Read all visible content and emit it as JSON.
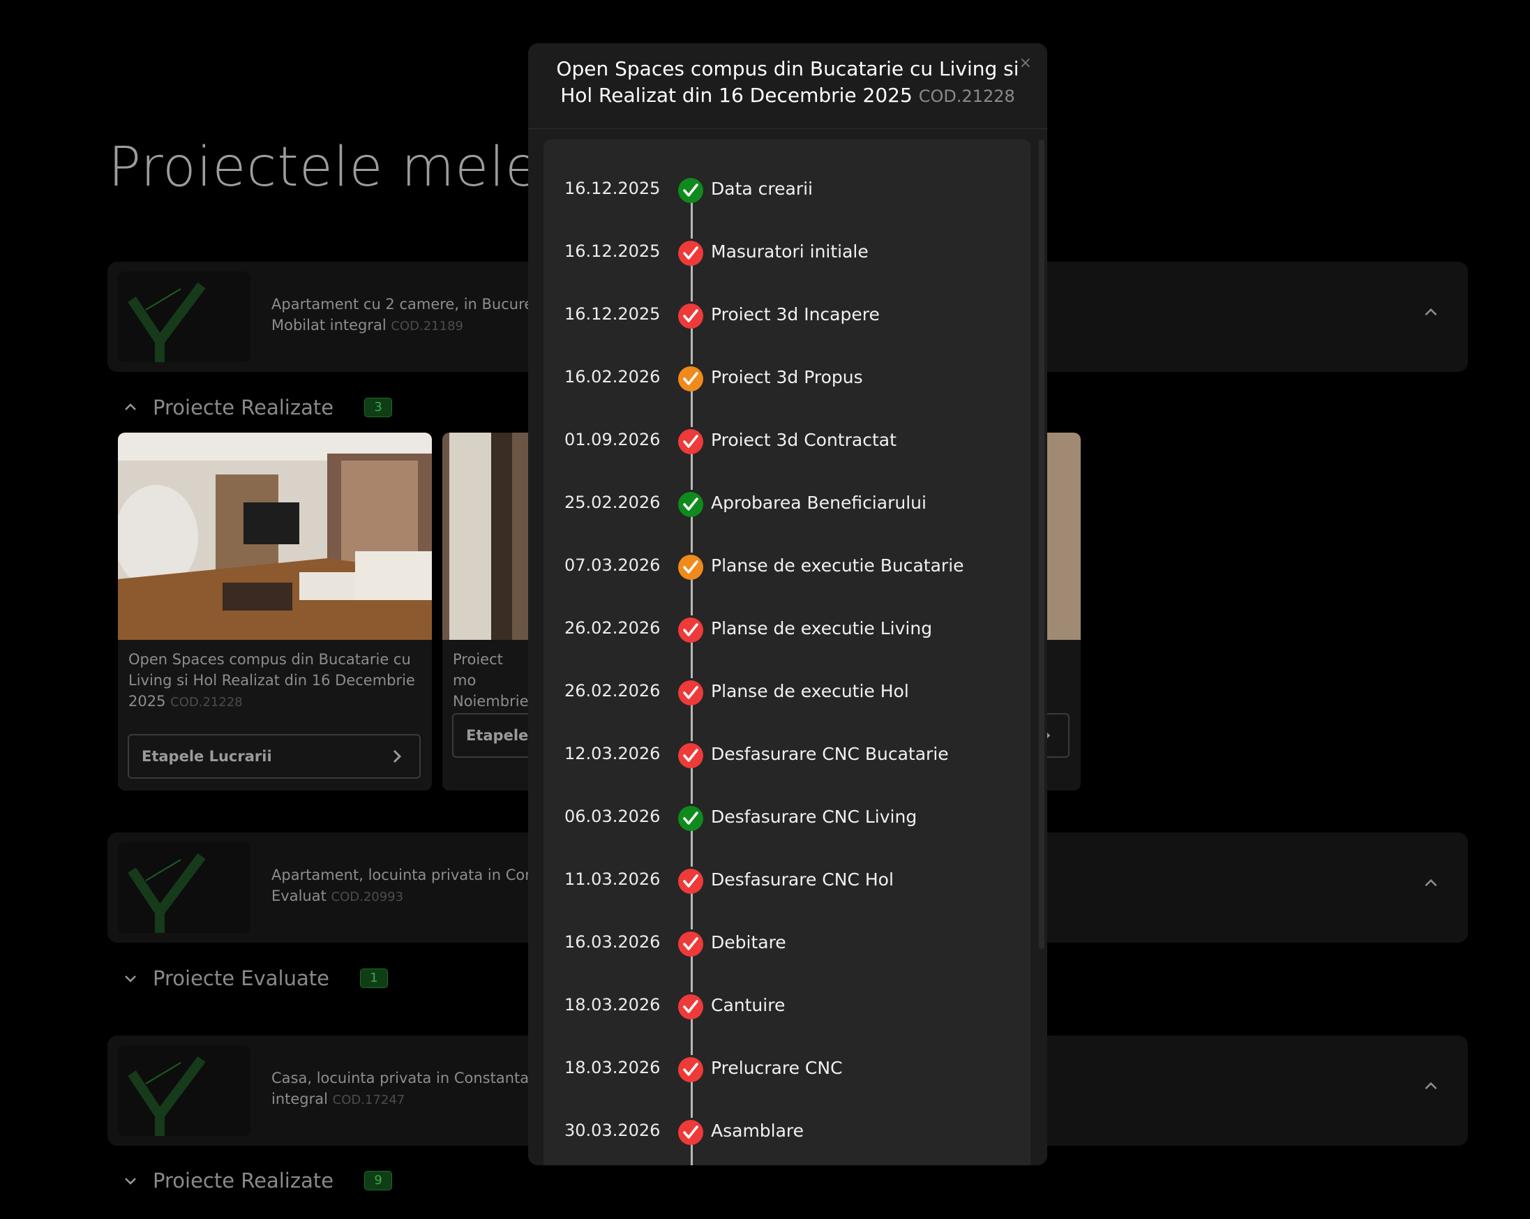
{
  "page": {
    "title": "Proiectele mele"
  },
  "projects": [
    {
      "title": "Apartament cu 2 camere, in Bucure",
      "status": "Mobilat integral",
      "code": "COD.21189",
      "section": {
        "label": "Proiecte Realizate",
        "count": "3",
        "cards": [
          {
            "title": "Open Spaces compus din Bucatarie cu Living si Hol Realizat din 16 Decembrie 2025",
            "code": "COD.21228",
            "button": "Etapele Lucrarii"
          },
          {
            "title": "Proiect mo Noiembrie",
            "code": "",
            "button": "Etapele"
          }
        ]
      }
    },
    {
      "title": "Apartament, locuinta privata in Cor",
      "status": "Evaluat",
      "code": "COD.20993",
      "section": {
        "label": "Proiecte Evaluate",
        "count": "1"
      }
    },
    {
      "title": "Casa, locuinta privata in Constanta,",
      "status": "integral",
      "code": "COD.17247",
      "section": {
        "label": "Proiecte Realizate",
        "count": "9"
      }
    }
  ],
  "modal": {
    "title": "Open Spaces compus din Bucatarie cu Living si Hol Realizat din 16 Decembrie 2025",
    "code": "COD.21228",
    "close": "×",
    "steps": [
      {
        "date": "16.12.2025",
        "label": "Data crearii",
        "status": "green"
      },
      {
        "date": "16.12.2025",
        "label": "Masuratori initiale",
        "status": "red"
      },
      {
        "date": "16.12.2025",
        "label": "Proiect 3d Incapere",
        "status": "red"
      },
      {
        "date": "16.02.2026",
        "label": "Proiect 3d Propus",
        "status": "orange"
      },
      {
        "date": "01.09.2026",
        "label": "Proiect 3d Contractat",
        "status": "red"
      },
      {
        "date": "25.02.2026",
        "label": "Aprobarea Beneficiarului",
        "status": "green"
      },
      {
        "date": "07.03.2026",
        "label": "Planse de executie Bucatarie",
        "status": "orange"
      },
      {
        "date": "26.02.2026",
        "label": "Planse de executie Living",
        "status": "red"
      },
      {
        "date": "26.02.2026",
        "label": "Planse de executie Hol",
        "status": "red"
      },
      {
        "date": "12.03.2026",
        "label": "Desfasurare CNC Bucatarie",
        "status": "red"
      },
      {
        "date": "06.03.2026",
        "label": "Desfasurare CNC Living",
        "status": "green"
      },
      {
        "date": "11.03.2026",
        "label": "Desfasurare CNC Hol",
        "status": "red"
      },
      {
        "date": "16.03.2026",
        "label": "Debitare",
        "status": "red"
      },
      {
        "date": "18.03.2026",
        "label": "Cantuire",
        "status": "red"
      },
      {
        "date": "18.03.2026",
        "label": "Prelucrare CNC",
        "status": "red"
      },
      {
        "date": "30.03.2026",
        "label": "Asamblare",
        "status": "red"
      }
    ]
  },
  "colors": {
    "green": "#0f8a1c",
    "red": "#ef3a3a",
    "orange": "#f08a1c",
    "badge": "#0f3d15"
  },
  "icons": {
    "step": "checkmark-icon",
    "close": "close-icon",
    "expand": "chevron-up-icon",
    "collapse": "chevron-down-icon",
    "next": "chevron-right-icon"
  }
}
